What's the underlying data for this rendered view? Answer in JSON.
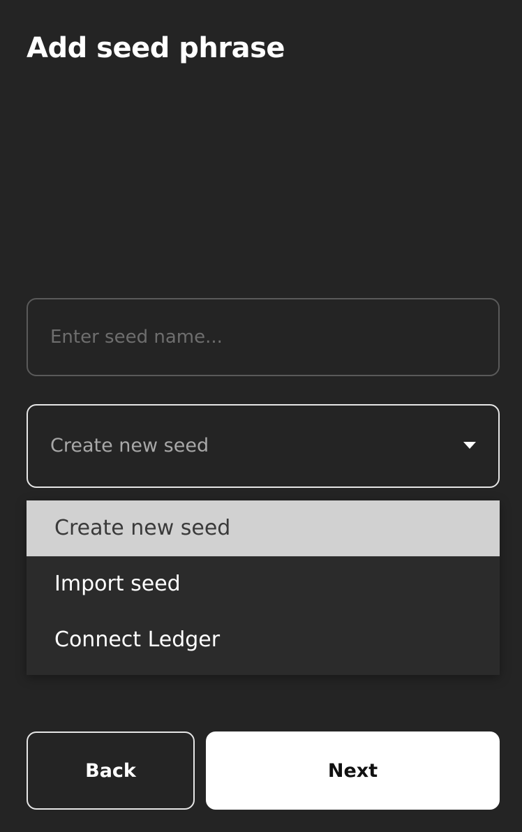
{
  "page": {
    "title": "Add seed phrase"
  },
  "seed_name": {
    "value": "",
    "placeholder": "Enter seed name..."
  },
  "seed_type": {
    "selected": "Create new seed",
    "options": [
      {
        "label": "Create new seed",
        "selected": true
      },
      {
        "label": "Import seed",
        "selected": false
      },
      {
        "label": "Connect Ledger",
        "selected": false
      }
    ]
  },
  "actions": {
    "back_label": "Back",
    "next_label": "Next"
  },
  "colors": {
    "background": "#242424",
    "menu_background": "#2b2b2b",
    "selected_option": "#d1d1d1",
    "primary_button": "#ffffff"
  }
}
